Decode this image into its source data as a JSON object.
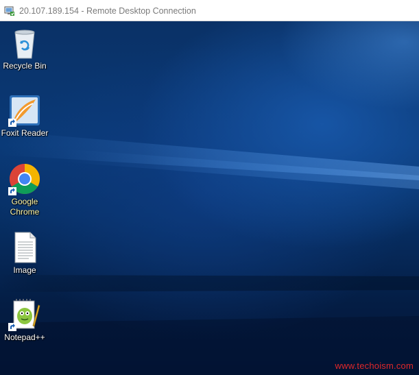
{
  "window": {
    "title": "20.107.189.154 - Remote Desktop Connection",
    "icon": "remote-desktop-icon"
  },
  "desktop": {
    "icons": [
      {
        "label": "Recycle Bin",
        "icon": "recycle-bin-icon",
        "shortcut": false
      },
      {
        "label": "Foxit Reader",
        "icon": "foxit-reader-icon",
        "shortcut": true
      },
      {
        "label": "Google Chrome",
        "icon": "chrome-icon",
        "shortcut": true
      },
      {
        "label": "Image",
        "icon": "text-document-icon",
        "shortcut": false
      },
      {
        "label": "Notepad++",
        "icon": "notepad-plus-plus-icon",
        "shortcut": true
      }
    ]
  },
  "watermark": "www.techoism.com",
  "colors": {
    "desktop_background": "#0a3166",
    "label_highlight": "#fff7a8",
    "watermark": "#e0282a"
  }
}
